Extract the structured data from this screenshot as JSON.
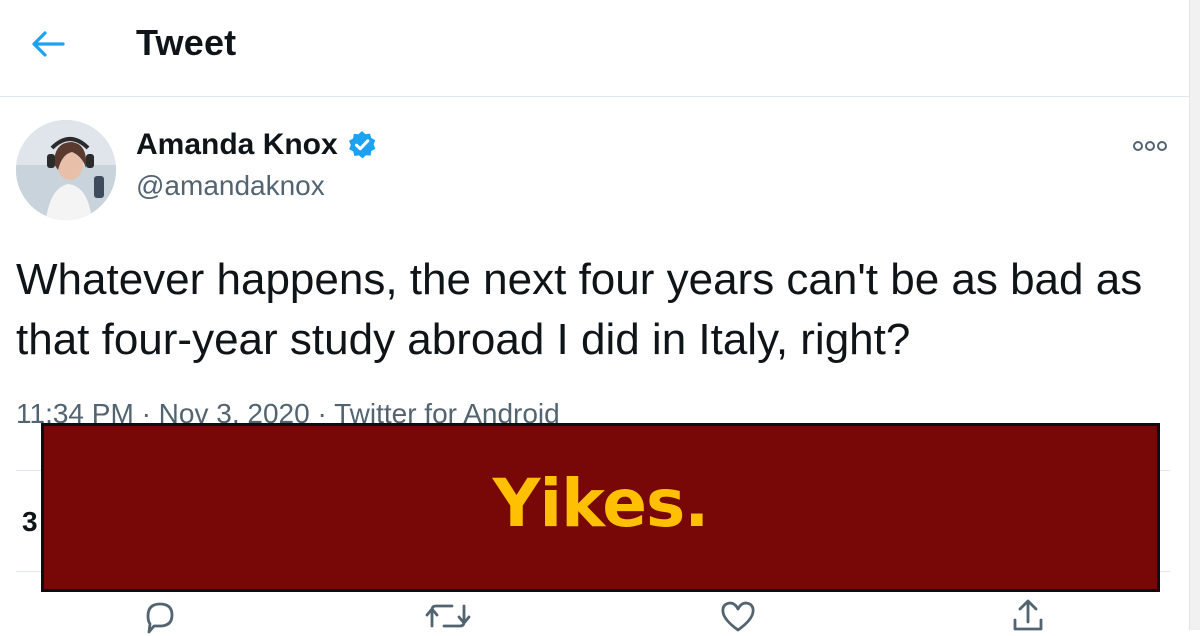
{
  "header": {
    "title": "Tweet",
    "back_icon": "arrow-left-icon"
  },
  "tweet": {
    "author_name": "Amanda Knox",
    "handle": "@amandaknox",
    "verified": true,
    "text": "Whatever happens, the next four years can't be as bad as that four-year study abroad I did in Italy, right?",
    "time": "11:34 PM",
    "date": "Nov 3, 2020",
    "source": "Twitter for Android",
    "separator": "·",
    "stats_prefix": "3"
  },
  "overlay": {
    "text": "Yikes."
  },
  "actions": [
    {
      "name": "reply-icon"
    },
    {
      "name": "retweet-icon"
    },
    {
      "name": "like-icon"
    },
    {
      "name": "share-icon"
    }
  ],
  "colors": {
    "accent": "#1da1f2",
    "overlay_bg": "#780707",
    "overlay_text": "#fec000"
  }
}
